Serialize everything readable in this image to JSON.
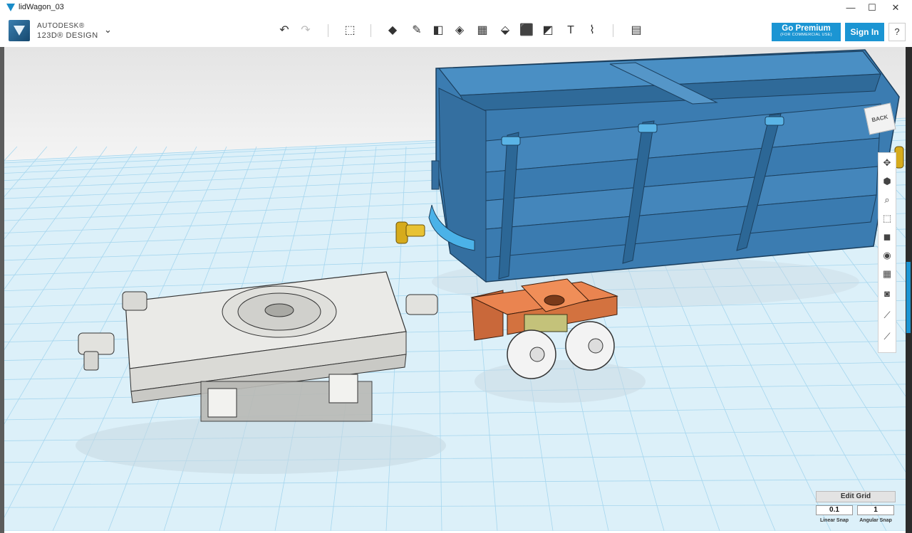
{
  "window": {
    "title": "lidWagon_03",
    "minimize_icon": "minimize-icon",
    "maximize_icon": "maximize-icon",
    "close_icon": "close-icon",
    "minimize_glyph": "—",
    "maximize_glyph": "☐",
    "close_glyph": "✕"
  },
  "brand": {
    "line1": "AUTODESK®",
    "line2": "123D® DESIGN",
    "menu_chevron": "⌄"
  },
  "toolbar": {
    "tools": [
      {
        "name": "undo-icon",
        "glyph": "↶",
        "enabled": true
      },
      {
        "name": "redo-icon",
        "glyph": "↷",
        "enabled": false
      },
      {
        "name": "transform-icon",
        "glyph": "⬚",
        "enabled": true
      },
      {
        "name": "primitives-icon",
        "glyph": "◆",
        "enabled": true
      },
      {
        "name": "sketch-icon",
        "glyph": "✎",
        "enabled": true
      },
      {
        "name": "construct-icon",
        "glyph": "◧",
        "enabled": true
      },
      {
        "name": "modify-icon",
        "glyph": "◈",
        "enabled": true
      },
      {
        "name": "pattern-icon",
        "glyph": "▦",
        "enabled": true
      },
      {
        "name": "grouping-icon",
        "glyph": "⬙",
        "enabled": true
      },
      {
        "name": "combine-icon",
        "glyph": "⬛",
        "enabled": true
      },
      {
        "name": "measure-icon",
        "glyph": "◩",
        "enabled": true
      },
      {
        "name": "text-icon",
        "glyph": "T",
        "enabled": true
      },
      {
        "name": "snap-icon",
        "glyph": "⌇",
        "enabled": true
      },
      {
        "name": "material-icon",
        "glyph": "▤",
        "enabled": true
      }
    ],
    "premium_label": "Go Premium",
    "premium_sub": "(FOR COMMERCIAL USE)",
    "signin_label": "Sign In",
    "help_label": "?"
  },
  "viewport": {
    "viewcube_label": "BACK",
    "nav_tools": [
      {
        "name": "pan-icon",
        "glyph": "✥"
      },
      {
        "name": "orbit-icon",
        "glyph": "⬢"
      },
      {
        "name": "zoom-icon",
        "glyph": "⌕"
      },
      {
        "name": "fit-icon",
        "glyph": "⬚"
      },
      {
        "name": "view-cube-icon",
        "glyph": "◼"
      },
      {
        "name": "visibility-icon",
        "glyph": "◉"
      },
      {
        "name": "grid-icon",
        "glyph": "▦"
      },
      {
        "name": "camera-icon",
        "glyph": "◙"
      },
      {
        "name": "material-view-icon",
        "glyph": "⟋"
      },
      {
        "name": "render-icon",
        "glyph": "⟋"
      }
    ],
    "edit_grid": {
      "button_label": "Edit Grid",
      "linear_snap_value": "0.1",
      "angular_snap_value": "1",
      "linear_snap_label": "Linear Snap",
      "angular_snap_label": "Angular Snap"
    },
    "colors": {
      "wagon_body": "#3e7fb3",
      "bogie_orange": "#e8804f",
      "chassis_gray": "#e6e6e4",
      "coupler_gold": "#d9b020",
      "grid_line": "#9ed3ec",
      "floor": "#d9eef8"
    }
  }
}
